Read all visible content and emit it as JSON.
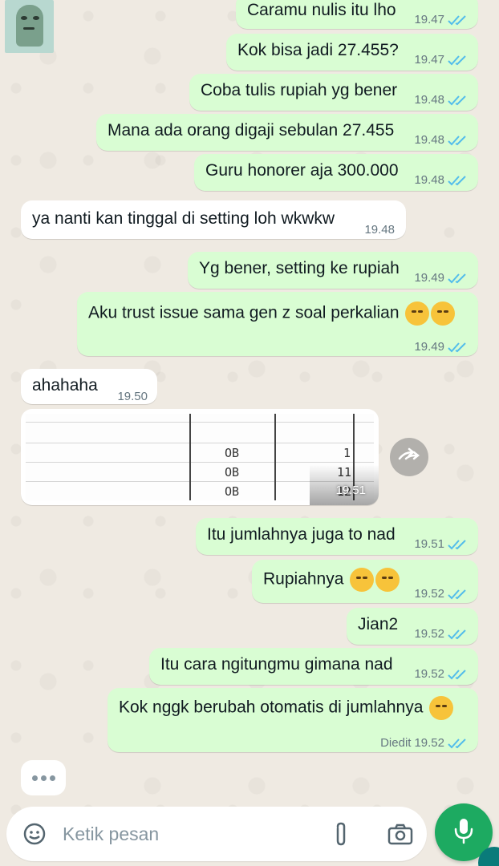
{
  "colors": {
    "outgoing": "#d9fdd3",
    "incoming": "#ffffff",
    "read_ticks": "#53bdeb",
    "mic": "#1daa61"
  },
  "messages": [
    {
      "dir": "out",
      "text": "Caramu nulis itu lho",
      "time": "19.47"
    },
    {
      "dir": "out",
      "text": "Kok bisa jadi 27.455?",
      "time": "19.47"
    },
    {
      "dir": "out",
      "text": "Coba tulis rupiah yg bener",
      "time": "19.48"
    },
    {
      "dir": "out",
      "text": "Mana ada orang digaji sebulan 27.455",
      "time": "19.48"
    },
    {
      "dir": "out",
      "text": "Guru honorer aja 300.000",
      "time": "19.48"
    },
    {
      "dir": "in",
      "text": "ya nanti kan tinggal di setting loh wkwkw",
      "time": "19.48"
    },
    {
      "dir": "out",
      "text": "Yg bener, setting ke rupiah",
      "time": "19.49"
    },
    {
      "dir": "out",
      "text": "Aku trust issue sama gen z soal perkalian",
      "time": "19.49",
      "emoji": [
        "rolling-laughing-emoji",
        "sneezing-emoji"
      ]
    },
    {
      "dir": "in",
      "text": "ahahaha",
      "time": "19.50"
    },
    {
      "dir": "out",
      "text": "Itu jumlahnya juga to nad",
      "time": "19.51"
    },
    {
      "dir": "out",
      "text": "Rupiahnya",
      "time": "19.52",
      "emoji": [
        "tired-face-emoji",
        "tired-face-emoji"
      ]
    },
    {
      "dir": "out",
      "text": "Jian2",
      "time": "19.52"
    },
    {
      "dir": "out",
      "text": "Itu cara ngitungmu gimana nad",
      "time": "19.52"
    },
    {
      "dir": "out",
      "text": "Kok nggk berubah otomatis di jumlahnya",
      "time": "19.52",
      "edited": "Diedit",
      "emoji": [
        "sneezing-emoji"
      ]
    }
  ],
  "image_message": {
    "time": "19.51",
    "cells": [
      "OB",
      "OB",
      "OB",
      "1",
      "11",
      "12"
    ],
    "forward_icon": "forward-icon"
  },
  "composer": {
    "placeholder": "Ketik pesan",
    "emoji_icon": "sticker-icon",
    "attach_icon": "paperclip-icon",
    "camera_icon": "camera-icon",
    "mic_icon": "mic-icon"
  }
}
